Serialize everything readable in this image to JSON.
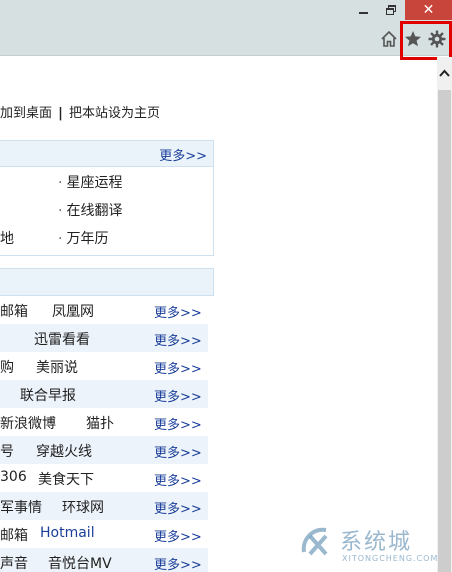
{
  "window": {
    "close_glyph": "✕"
  },
  "toolbar": {
    "home_icon": "home-icon",
    "favorites_icon": "star-icon",
    "tools_icon": "gear-icon",
    "highlight_color": "#e00000"
  },
  "top_links": {
    "add_desktop": "加到桌面",
    "separator": "|",
    "set_homepage": "把本站设为主页"
  },
  "tools_panel": {
    "more": "更多>>",
    "links": [
      "星座运程",
      "在线翻译",
      "万年历"
    ],
    "partial_left": "地"
  },
  "sites_panel": {
    "rows": [
      {
        "c1": "邮箱",
        "c2": "凤凰网",
        "c3": "",
        "more": "更多>>"
      },
      {
        "c1": "",
        "c2": "迅雷看看",
        "c3": "",
        "more": "更多>>"
      },
      {
        "c1": "购",
        "c2": "美丽说",
        "c3": "",
        "more": "更多>>"
      },
      {
        "c1": "",
        "c2": "联合早报",
        "c3": "",
        "more": "更多>>"
      },
      {
        "c1": "新浪微博",
        "c2": "猫扑",
        "c3": "",
        "more": "更多>>"
      },
      {
        "c1": "号",
        "c2": "穿越火线",
        "c3": "",
        "more": "更多>>"
      },
      {
        "c1": "306",
        "c2": "美食天下",
        "c3": "",
        "more": "更多>>"
      },
      {
        "c1": "军事情",
        "c2": "环球网",
        "c3": "",
        "more": "更多>>"
      },
      {
        "c1": "邮箱",
        "c2": "Hotmail",
        "c3": "",
        "more": "更多>>"
      },
      {
        "c1": "声音",
        "c2": "音悦台MV",
        "c3": "",
        "more": "更多>>"
      }
    ]
  },
  "watermark": {
    "main": "系统城",
    "sub": "XITONGCHENG.COM"
  },
  "colors": {
    "chrome": "#d6e0e0",
    "close_button": "#c8453b",
    "link_blue": "#1a3e9a",
    "panel_header": "#eaf2fa"
  }
}
